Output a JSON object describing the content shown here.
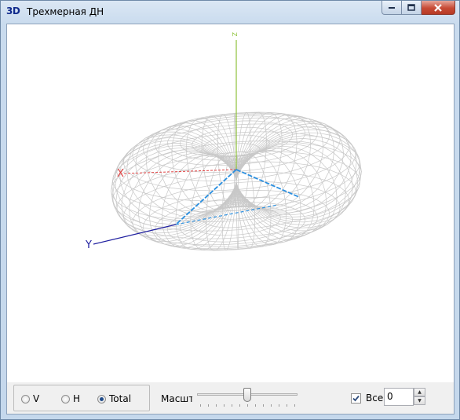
{
  "window": {
    "icon_text": "3D",
    "title": "Трехмерная ДН",
    "buttons": [
      "minimize",
      "maximize",
      "close"
    ]
  },
  "plot": {
    "axis_labels": {
      "x": "X",
      "y": "Y",
      "z": "Z"
    },
    "colors": {
      "mesh": "#c8c8c8",
      "x_axis": "#e04040",
      "y_axis": "#1f1fa0",
      "z_axis": "#8fc23c",
      "inner_axes": "#2a8fe0"
    }
  },
  "controls": {
    "radio_options": [
      {
        "label": "V",
        "selected": false
      },
      {
        "label": "H",
        "selected": false
      },
      {
        "label": "Total",
        "selected": true
      }
    ],
    "scale_label": "Масштаб",
    "scale_slider_value": 0.5,
    "all_checkbox_label": "Все",
    "all_checked": true,
    "spin_value": "0"
  }
}
